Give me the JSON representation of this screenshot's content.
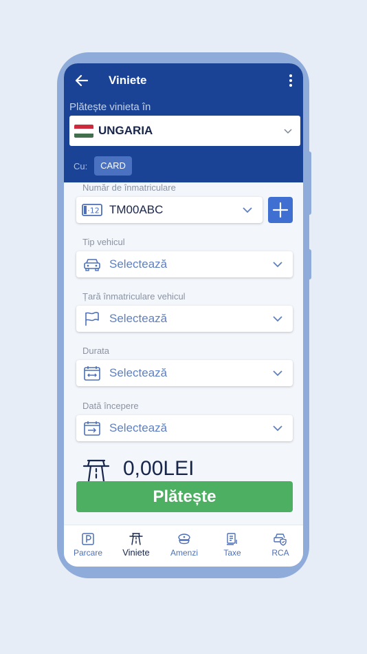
{
  "header": {
    "title": "Viniete"
  },
  "country": {
    "label": "Plătește vinieta în",
    "selected": "UNGARIA",
    "flag_colors": [
      "#cd2a3e",
      "#ffffff",
      "#436f4d"
    ]
  },
  "payment": {
    "method_label": "Cu:",
    "method": "CARD"
  },
  "form": {
    "plate": {
      "label": "Număr de înmatriculare",
      "value": "TM00ABC",
      "plate_icon_text": "·12"
    },
    "vehicle_type": {
      "label": "Tip vehicul",
      "placeholder": "Selectează"
    },
    "registration_country": {
      "label": "Țară înmatriculare vehicul",
      "placeholder": "Selectează"
    },
    "duration": {
      "label": "Durata",
      "placeholder": "Selectează"
    },
    "start_date": {
      "label": "Dată începere",
      "placeholder": "Selectează"
    }
  },
  "total": {
    "amount": "0,00LEI"
  },
  "pay_button": {
    "label": "Plătește"
  },
  "nav": {
    "items": [
      {
        "label": "Parcare",
        "icon": "parking-icon"
      },
      {
        "label": "Viniete",
        "icon": "toll-road-icon",
        "active": true
      },
      {
        "label": "Amenzi",
        "icon": "police-cap-icon"
      },
      {
        "label": "Taxe",
        "icon": "tax-document-icon"
      },
      {
        "label": "RCA",
        "icon": "car-shield-icon"
      }
    ]
  },
  "colors": {
    "primary": "#1a4395",
    "accent": "#3f6fd1",
    "success": "#4caf61",
    "frame": "#8fabd9"
  }
}
